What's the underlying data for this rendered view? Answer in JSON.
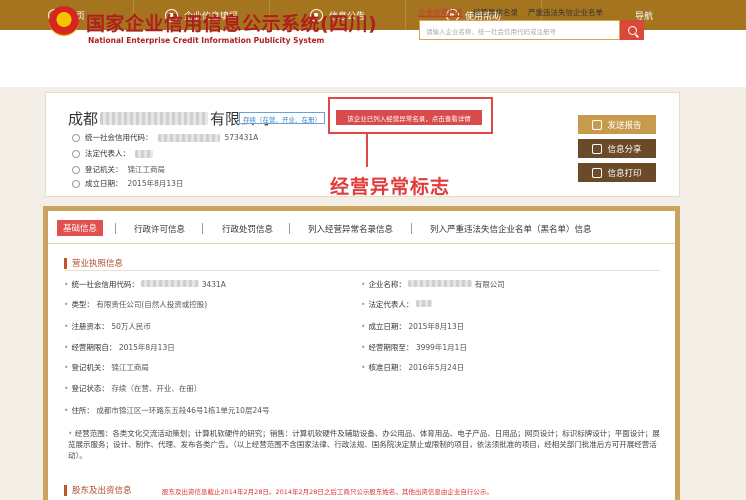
{
  "nav": {
    "items": [
      {
        "label": "首页",
        "icon": "home-icon"
      },
      {
        "label": "企业信息填报",
        "icon": "edit-icon"
      },
      {
        "label": "信息公告",
        "icon": "notice-icon"
      },
      {
        "label": "使用帮助",
        "icon": "help-icon"
      },
      {
        "label": "导航",
        "icon": ""
      }
    ]
  },
  "header": {
    "title": "国家企业信用信息公示系统(四川)",
    "subtitle": "National Enterprise Credit Information Publicity System",
    "quick_links": [
      "企业信用信息",
      "经营异常名录",
      "严重违法失信企业名单"
    ],
    "search_placeholder": "请输入企业名称、统一社会信用代码或注册号"
  },
  "company": {
    "name_prefix": "成都",
    "name_suffix": "有限公司",
    "status": "存续（在营、开业、在册）",
    "anomaly_badge": "该企业已列入经营异常名录，点击查看详情",
    "fields": [
      {
        "label": "统一社会信用代码：",
        "value": "573431A"
      },
      {
        "label": "法定代表人：",
        "value": ""
      },
      {
        "label": "登记机关：",
        "value": "锦江工商局"
      },
      {
        "label": "成立日期：",
        "value": "2015年8月13日"
      }
    ]
  },
  "annotation": {
    "label": "经营异常标志"
  },
  "actions": [
    {
      "label": "发送报告",
      "color": "#c89a4e"
    },
    {
      "label": "信息分享",
      "color": "#6b4a2a"
    },
    {
      "label": "信息打印",
      "color": "#6b4a2a"
    }
  ],
  "tabs": [
    "基础信息",
    "行政许可信息",
    "行政处罚信息",
    "列入经营异常名录信息",
    "列入严重违法失信企业名单（黑名单）信息"
  ],
  "license": {
    "section_title": "营业执照信息",
    "credit_code": {
      "label": "统一社会信用代码：",
      "value": "3431A"
    },
    "company_name": {
      "label": "企业名称：",
      "value": "有限公司"
    },
    "type": {
      "label": "类型：",
      "value": "有限责任公司(自然人投资或控股)"
    },
    "legal_rep": {
      "label": "法定代表人：",
      "value": ""
    },
    "capital": {
      "label": "注册资本：",
      "value": "50万人民币"
    },
    "established": {
      "label": "成立日期：",
      "value": "2015年8月13日"
    },
    "term_from": {
      "label": "经营期限自：",
      "value": "2015年8月13日"
    },
    "term_to": {
      "label": "经营期限至：",
      "value": "3999年1月1日"
    },
    "authority": {
      "label": "登记机关：",
      "value": "锦江工商局"
    },
    "approval_date": {
      "label": "核准日期：",
      "value": "2016年5月24日"
    },
    "reg_status": {
      "label": "登记状态：",
      "value": "存续（在营、开业、在册）"
    },
    "address": {
      "label": "住所：",
      "value": "成都市锦江区一环路东五段46号1栋1单元10层24号"
    },
    "scope_label": "经营范围：",
    "scope": "各类文化交流活动策划；计算机软硬件的研究；销售：计算机软硬件及辅助设备、办公用品、体育用品、电子产品、日用品；网页设计；标识标牌设计；平面设计；展览展示服务；设计、制作、代理、发布各类广告。（以上经营范围不含国家法律、行政法规、国务院决定禁止或限制的项目，依法须批准的项目，经相关部门批准后方可开展经营活动）。"
  },
  "shareholders": {
    "section_title": "股东及出资信息",
    "note": "股东及出资信息截止2014年2月28日。2014年2月28日之后工商只公示股东姓名，其他出资信息由企业自行公示。"
  }
}
